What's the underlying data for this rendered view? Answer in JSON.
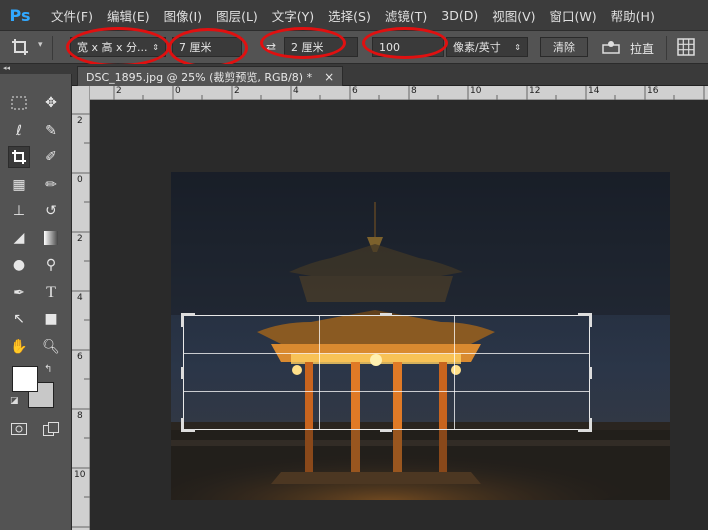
{
  "app": {
    "logo": "Ps"
  },
  "menubar": [
    "文件(F)",
    "编辑(E)",
    "图像(I)",
    "图层(L)",
    "文字(Y)",
    "选择(S)",
    "滤镜(T)",
    "3D(D)",
    "视图(V)",
    "窗口(W)",
    "帮助(H)"
  ],
  "options": {
    "ratio_select": "宽 x 高 x 分...",
    "width_value": "7 厘米",
    "height_value": "2 厘米",
    "resolution_value": "100",
    "resolution_unit": "像素/英寸",
    "clear_label": "清除",
    "straighten_label": "拉直"
  },
  "document": {
    "tab_title": "DSC_1895.jpg @ 25% (裁剪预览, RGB/8) *",
    "close_glyph": "×"
  },
  "rulers": {
    "h_labels": [
      "2",
      "0",
      "2",
      "4",
      "6",
      "8",
      "10",
      "12",
      "14",
      "16"
    ],
    "v_labels": [
      "2",
      "0",
      "2",
      "4",
      "6",
      "8",
      "10"
    ]
  },
  "annotations": {
    "color": "#e01010"
  }
}
